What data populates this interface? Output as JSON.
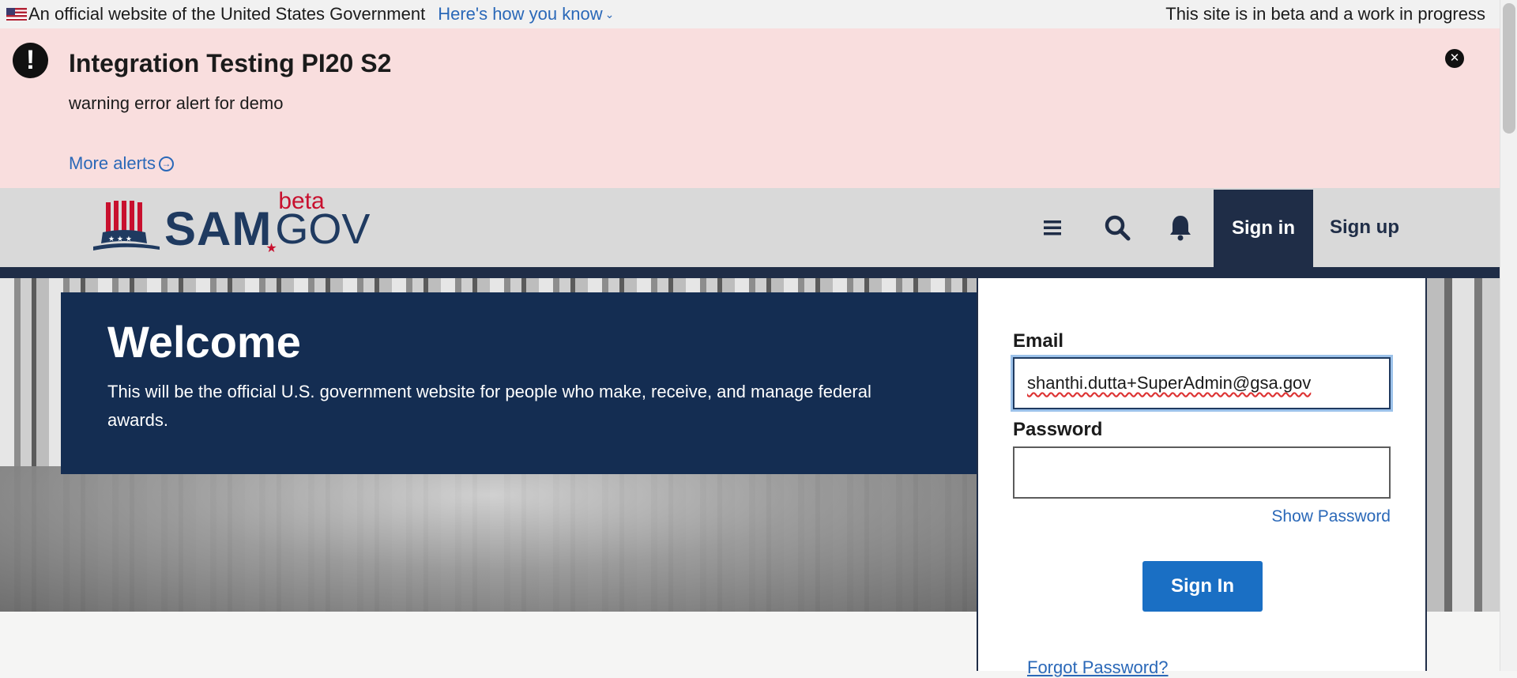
{
  "gov_banner": {
    "official_text": "An official website of the United States Government",
    "how_link": "Here's how you know",
    "beta_note": "This site is in beta and a work in progress"
  },
  "alert": {
    "title": "Integration Testing PI20 S2",
    "body": "warning error alert for demo",
    "more_link": "More alerts",
    "icon": "exclamation-icon",
    "close_icon": "close-icon"
  },
  "header": {
    "logo_main": "SAM",
    "logo_beta": "beta",
    "logo_gov": "GOV",
    "nav": {
      "sign_in": "Sign in",
      "sign_up": "Sign up"
    },
    "icons": [
      "menu-icon",
      "search-icon",
      "bell-icon"
    ]
  },
  "hero": {
    "title": "Welcome",
    "text": "This will be the official U.S. government website for people who make, receive, and manage federal awards."
  },
  "signin_form": {
    "email_label": "Email",
    "email_value": "shanthi.dutta+SuperAdmin@gsa.gov",
    "password_label": "Password",
    "password_value": "",
    "show_password": "Show Password",
    "submit": "Sign In",
    "forgot": "Forgot Password?"
  },
  "colors": {
    "alert_bg": "#f9dede",
    "header_bg": "#d9d9d9",
    "navy": "#1f2d47",
    "welcome_bg": "#142d52",
    "primary_button": "#1a6fc4",
    "link": "#2a68b8"
  }
}
